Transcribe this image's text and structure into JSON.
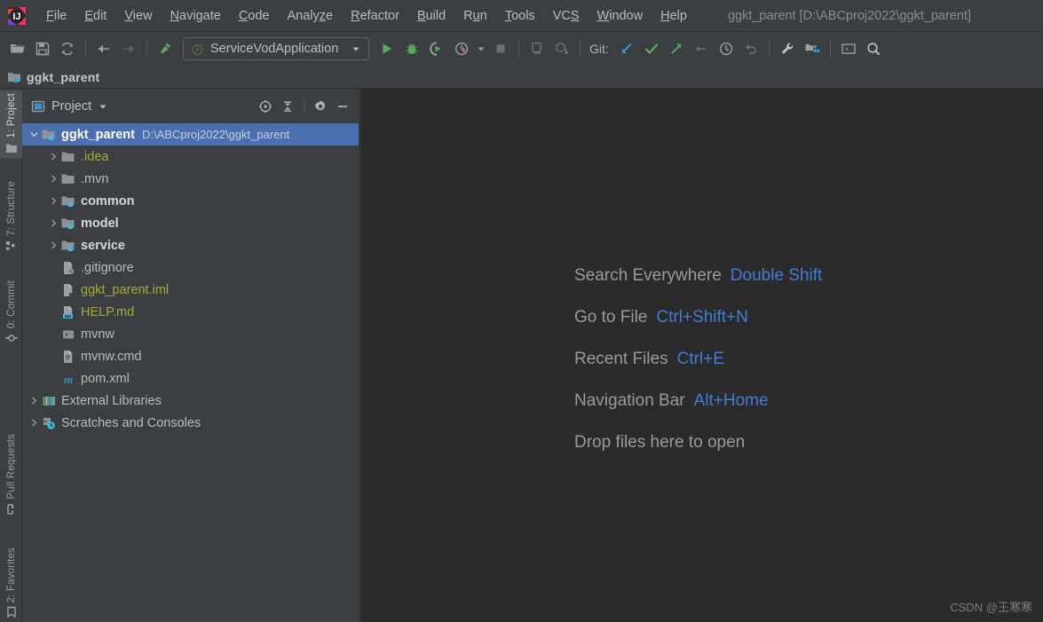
{
  "window": {
    "title": "ggkt_parent [D:\\ABCproj2022\\ggkt_parent]",
    "logo_icon": "intellij-idea-logo"
  },
  "menubar": {
    "items": [
      {
        "label": "File",
        "mnemonic": "F"
      },
      {
        "label": "Edit",
        "mnemonic": "E"
      },
      {
        "label": "View",
        "mnemonic": "V"
      },
      {
        "label": "Navigate",
        "mnemonic": "N"
      },
      {
        "label": "Code",
        "mnemonic": "C"
      },
      {
        "label": "Analyze",
        "mnemonic": "z"
      },
      {
        "label": "Refactor",
        "mnemonic": "R"
      },
      {
        "label": "Build",
        "mnemonic": "B"
      },
      {
        "label": "Run",
        "mnemonic": "u"
      },
      {
        "label": "Tools",
        "mnemonic": "T"
      },
      {
        "label": "VCS",
        "mnemonic": "S"
      },
      {
        "label": "Window",
        "mnemonic": "W"
      },
      {
        "label": "Help",
        "mnemonic": "H"
      }
    ]
  },
  "toolbar": {
    "open_icon": "open-folder-icon",
    "save_icon": "save-icon",
    "sync_icon": "sync-refresh-icon",
    "back_icon": "arrow-left-icon",
    "forward_icon": "arrow-right-icon",
    "build_icon": "hammer-build-icon",
    "run_config": {
      "label": "ServiceVodApplication",
      "icon": "spring-boot-icon",
      "dropdown_icon": "chevron-down-icon"
    },
    "run_icon": "run-play-icon",
    "debug_icon": "debug-bug-icon",
    "run_coverage_icon": "run-with-coverage-icon",
    "profiler_icon": "profiler-icon",
    "profiler_dropdown_icon": "chevron-down-icon",
    "stop_icon": "stop-square-icon",
    "notifications_icon": "inspect-icon",
    "module_icon": "module-download-icon",
    "git_label": "Git:",
    "git_update_icon": "update-project-icon",
    "git_commit_icon": "commit-check-icon",
    "git_push_icon": "push-arrow-icon",
    "git_rollback_icon": "revert-arrow-icon",
    "history_icon": "clock-history-icon",
    "undo_icon": "undo-arrow-icon",
    "settings_icon": "wrench-settings-icon",
    "project_structure_icon": "project-structure-icon",
    "terminal_icon": "terminal-icon",
    "search_icon": "search-magnifier-icon"
  },
  "breadcrumb": {
    "icon": "module-folder-icon",
    "label": "ggkt_parent"
  },
  "stripe": {
    "left_top": [
      {
        "label": "1: Project",
        "icon": "project-folder-icon",
        "active": true
      },
      {
        "label": "7: Structure",
        "icon": "structure-icon",
        "active": false
      },
      {
        "label": "0: Commit",
        "icon": "commit-node-icon",
        "active": false
      }
    ],
    "left_bottom": [
      {
        "label": "Pull Requests",
        "icon": "pull-request-icon",
        "active": false
      },
      {
        "label": "2: Favorites",
        "icon": "favorites-icon",
        "active": false
      }
    ]
  },
  "project_panel": {
    "icon": "project-view-icon",
    "title": "Project",
    "dropdown_icon": "chevron-down-icon",
    "tools": [
      {
        "name": "select-opened-file-icon",
        "label": "Select Opened File"
      },
      {
        "name": "collapse-all-icon",
        "label": "Collapse All"
      },
      {
        "name": "gear-settings-icon",
        "label": "Options"
      },
      {
        "name": "hide-minimize-icon",
        "label": "Hide"
      }
    ],
    "tree": [
      {
        "label": "ggkt_parent",
        "path": "D:\\ABCproj2022\\ggkt_parent",
        "icon": "module-folder-icon",
        "arrow": "expanded",
        "indent": 0,
        "selected": true,
        "style": "white"
      },
      {
        "label": ".idea",
        "icon": "folder-icon",
        "arrow": "collapsed",
        "indent": 1,
        "selected": false,
        "style": "yellow"
      },
      {
        "label": ".mvn",
        "icon": "folder-icon",
        "arrow": "collapsed",
        "indent": 1,
        "selected": false,
        "style": "plain"
      },
      {
        "label": "common",
        "icon": "module-folder-icon",
        "arrow": "collapsed",
        "indent": 1,
        "selected": false,
        "style": "bold"
      },
      {
        "label": "model",
        "icon": "module-folder-icon",
        "arrow": "collapsed",
        "indent": 1,
        "selected": false,
        "style": "bold"
      },
      {
        "label": "service",
        "icon": "module-folder-icon",
        "arrow": "collapsed",
        "indent": 1,
        "selected": false,
        "style": "bold"
      },
      {
        "label": ".gitignore",
        "icon": "gitignore-file-icon",
        "arrow": "none",
        "indent": 1,
        "selected": false,
        "style": "plain"
      },
      {
        "label": "ggkt_parent.iml",
        "icon": "iml-file-icon",
        "arrow": "none",
        "indent": 1,
        "selected": false,
        "style": "yellow"
      },
      {
        "label": "HELP.md",
        "icon": "markdown-file-icon",
        "arrow": "none",
        "indent": 1,
        "selected": false,
        "style": "yellow"
      },
      {
        "label": "mvnw",
        "icon": "shell-script-icon",
        "arrow": "none",
        "indent": 1,
        "selected": false,
        "style": "plain"
      },
      {
        "label": "mvnw.cmd",
        "icon": "cmd-file-icon",
        "arrow": "none",
        "indent": 1,
        "selected": false,
        "style": "plain"
      },
      {
        "label": "pom.xml",
        "icon": "maven-pom-icon",
        "arrow": "none",
        "indent": 1,
        "selected": false,
        "style": "plain"
      },
      {
        "label": "External Libraries",
        "icon": "external-libraries-icon",
        "arrow": "collapsed",
        "indent": 0,
        "selected": false,
        "style": "plain"
      },
      {
        "label": "Scratches and Consoles",
        "icon": "scratches-icon",
        "arrow": "collapsed",
        "indent": 0,
        "selected": false,
        "style": "plain"
      }
    ]
  },
  "editor": {
    "hints": [
      {
        "label": "Search Everywhere",
        "key": "Double Shift"
      },
      {
        "label": "Go to File",
        "key": "Ctrl+Shift+N"
      },
      {
        "label": "Recent Files",
        "key": "Ctrl+E"
      },
      {
        "label": "Navigation Bar",
        "key": "Alt+Home"
      },
      {
        "label": "Drop files here to open",
        "key": ""
      }
    ],
    "watermark": "CSDN @王寒寒"
  },
  "colors": {
    "chrome_bg": "#3c3f41",
    "editor_bg": "#2b2b2b",
    "selection_blue": "#4b6eaf",
    "accent_blue": "#417cd6",
    "folder_yellow": "#a9a937",
    "run_green": "#499c54",
    "text_gray": "#bbbbbb"
  }
}
